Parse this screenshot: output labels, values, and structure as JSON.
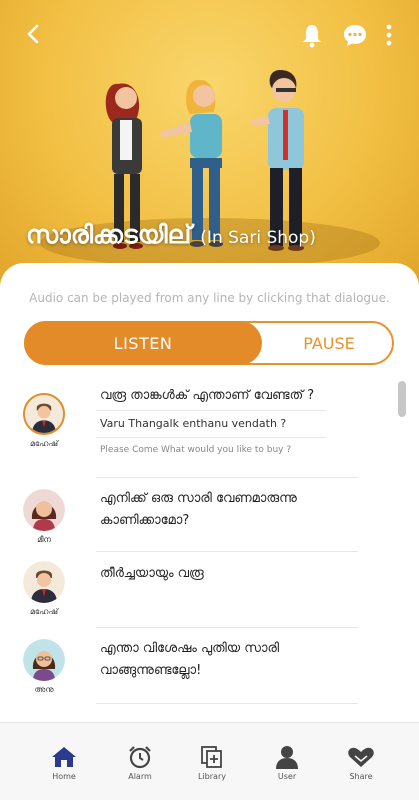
{
  "hero": {
    "title_ml": "സാരിക്കടയില്",
    "title_en": "(In Sari Shop)"
  },
  "hint": "Audio can be played from any line by clicking that dialogue.",
  "controls": {
    "listen_label": "LISTEN",
    "pause_label": "PAUSE",
    "active": "listen"
  },
  "dialogues": [
    {
      "speaker": "മഹേഷ്",
      "avatar": "mahesh-avatar",
      "text_ml": "വരൂ താങ്കൾക് എന്താണ് വേണ്ടത് ?",
      "transliteration": "Varu Thangalk enthanu vendath ?",
      "translation": "Please Come What would you like to buy ?"
    },
    {
      "speaker": "മീന",
      "avatar": "meena-avatar",
      "text_ml": "എനിക്ക് ഒരു സാരി വേണമാരുന്നു കാണിക്കാമോ?"
    },
    {
      "speaker": "മഹേഷ്",
      "avatar": "mahesh-avatar",
      "text_ml": "തീർച്ചയായും വരൂ"
    },
    {
      "speaker": "അനു",
      "avatar": "anu-avatar",
      "text_ml": "എന്താ വിശേഷം പുതിയ സാരി വാങ്ങുന്നുണ്ടല്ലോ!"
    }
  ],
  "nav": [
    {
      "label": "Home",
      "icon": "home-icon",
      "active": true
    },
    {
      "label": "Alarm",
      "icon": "alarm-clock-icon"
    },
    {
      "label": "Library",
      "icon": "library-icon"
    },
    {
      "label": "User",
      "icon": "user-icon"
    },
    {
      "label": "Share",
      "icon": "share-handshake-icon"
    }
  ],
  "colors": {
    "accent": "#e38a29",
    "hero": "#f2c044",
    "nav_active": "#2b3a8f"
  }
}
